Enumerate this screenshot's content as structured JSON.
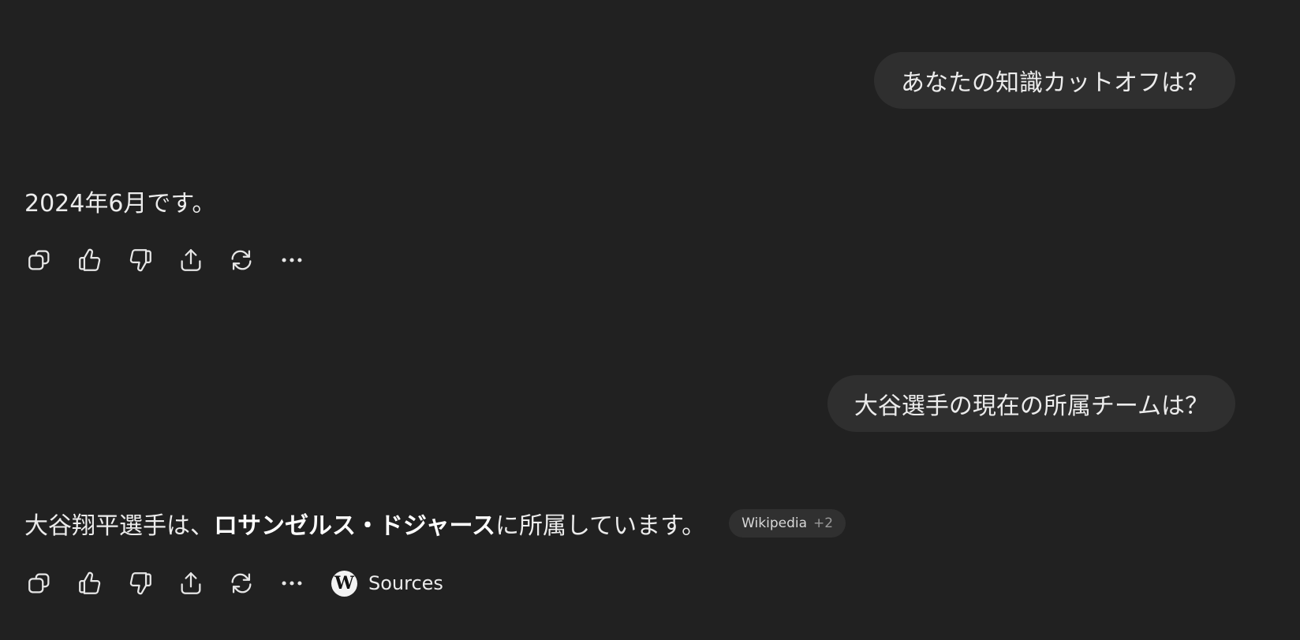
{
  "conversation": [
    {
      "user": {
        "text": "あなたの知識カットオフは？"
      },
      "assistant": {
        "text": "2024年6月です。"
      }
    },
    {
      "user": {
        "text": "大谷選手の現在の所属チームは？"
      },
      "assistant": {
        "text_before": "大谷翔平選手は、",
        "text_bold": "ロサンゼルス・ドジャース",
        "text_after": " に所属しています。",
        "citation": {
          "source": "Wikipedia",
          "more": "+2"
        },
        "sources_label": "Sources"
      }
    }
  ],
  "actions": [
    "copy-icon",
    "thumbs-up-icon",
    "thumbs-down-icon",
    "share-icon",
    "regenerate-icon",
    "more-icon"
  ],
  "colors": {
    "background": "#212121",
    "user_bubble": "#2f2f2f",
    "text": "#ececec",
    "citation_pill": "#303030"
  }
}
